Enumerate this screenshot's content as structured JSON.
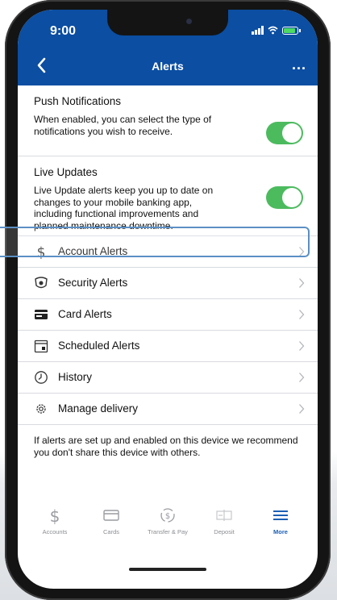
{
  "status_bar": {
    "time": "9:00"
  },
  "header": {
    "title": "Alerts",
    "more_label": "..."
  },
  "push": {
    "title": "Push Notifications",
    "description": "When enabled, you can select the type of notifications you wish to receive.",
    "enabled": true
  },
  "live": {
    "title": "Live Updates",
    "description": "Live Update alerts keep you up to date on changes to your mobile banking app, including functional improvements and planned maintenance downtime.",
    "enabled": true
  },
  "menu": [
    {
      "label": "Account Alerts",
      "icon": "dollar-icon"
    },
    {
      "label": "Security Alerts",
      "icon": "security-icon"
    },
    {
      "label": "Card Alerts",
      "icon": "card-icon"
    },
    {
      "label": "Scheduled Alerts",
      "icon": "calendar-icon"
    },
    {
      "label": "History",
      "icon": "history-icon"
    },
    {
      "label": "Manage delivery",
      "icon": "gear-icon"
    }
  ],
  "footer_note": "If alerts are set up and enabled on this device we recommend you don't share this device with others.",
  "tabs": [
    {
      "label": "Accounts",
      "icon": "dollar-icon"
    },
    {
      "label": "Cards",
      "icon": "card-icon"
    },
    {
      "label": "Transfer & Pay",
      "icon": "transfer-icon"
    },
    {
      "label": "Deposit",
      "icon": "check-deposit-icon"
    },
    {
      "label": "More",
      "icon": "menu-icon",
      "active": true
    }
  ],
  "colors": {
    "header": "#0b4ea2",
    "toggle_on": "#4cbb5e",
    "active_tab": "#1b5fb5",
    "highlight": "#5b8fc4"
  }
}
